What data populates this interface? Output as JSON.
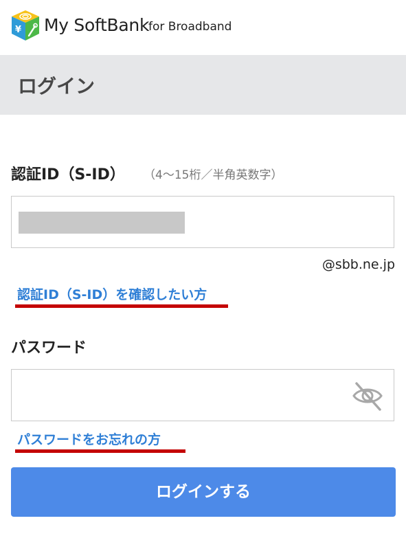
{
  "header": {
    "brand": "My SoftBank",
    "brand_sub": "for Broadband",
    "logo_icon": "softbank-cube-logo"
  },
  "page": {
    "title": "ログイン"
  },
  "form": {
    "id_label": "認証ID（S-ID）",
    "id_hint": "（4〜15桁／半角英数字）",
    "id_domain": "@sbb.ne.jp",
    "id_help_link": "認証ID（S-ID）を確認したい方",
    "password_label": "パスワード",
    "password_toggle_icon": "eye-slash-icon",
    "password_help_link": "パスワードをお忘れの方",
    "submit_label": "ログインする"
  },
  "colors": {
    "accent": "#4d8ae8",
    "link": "#2f7fd6",
    "underline_highlight": "#c40000",
    "title_bar": "#e6e7e9"
  }
}
